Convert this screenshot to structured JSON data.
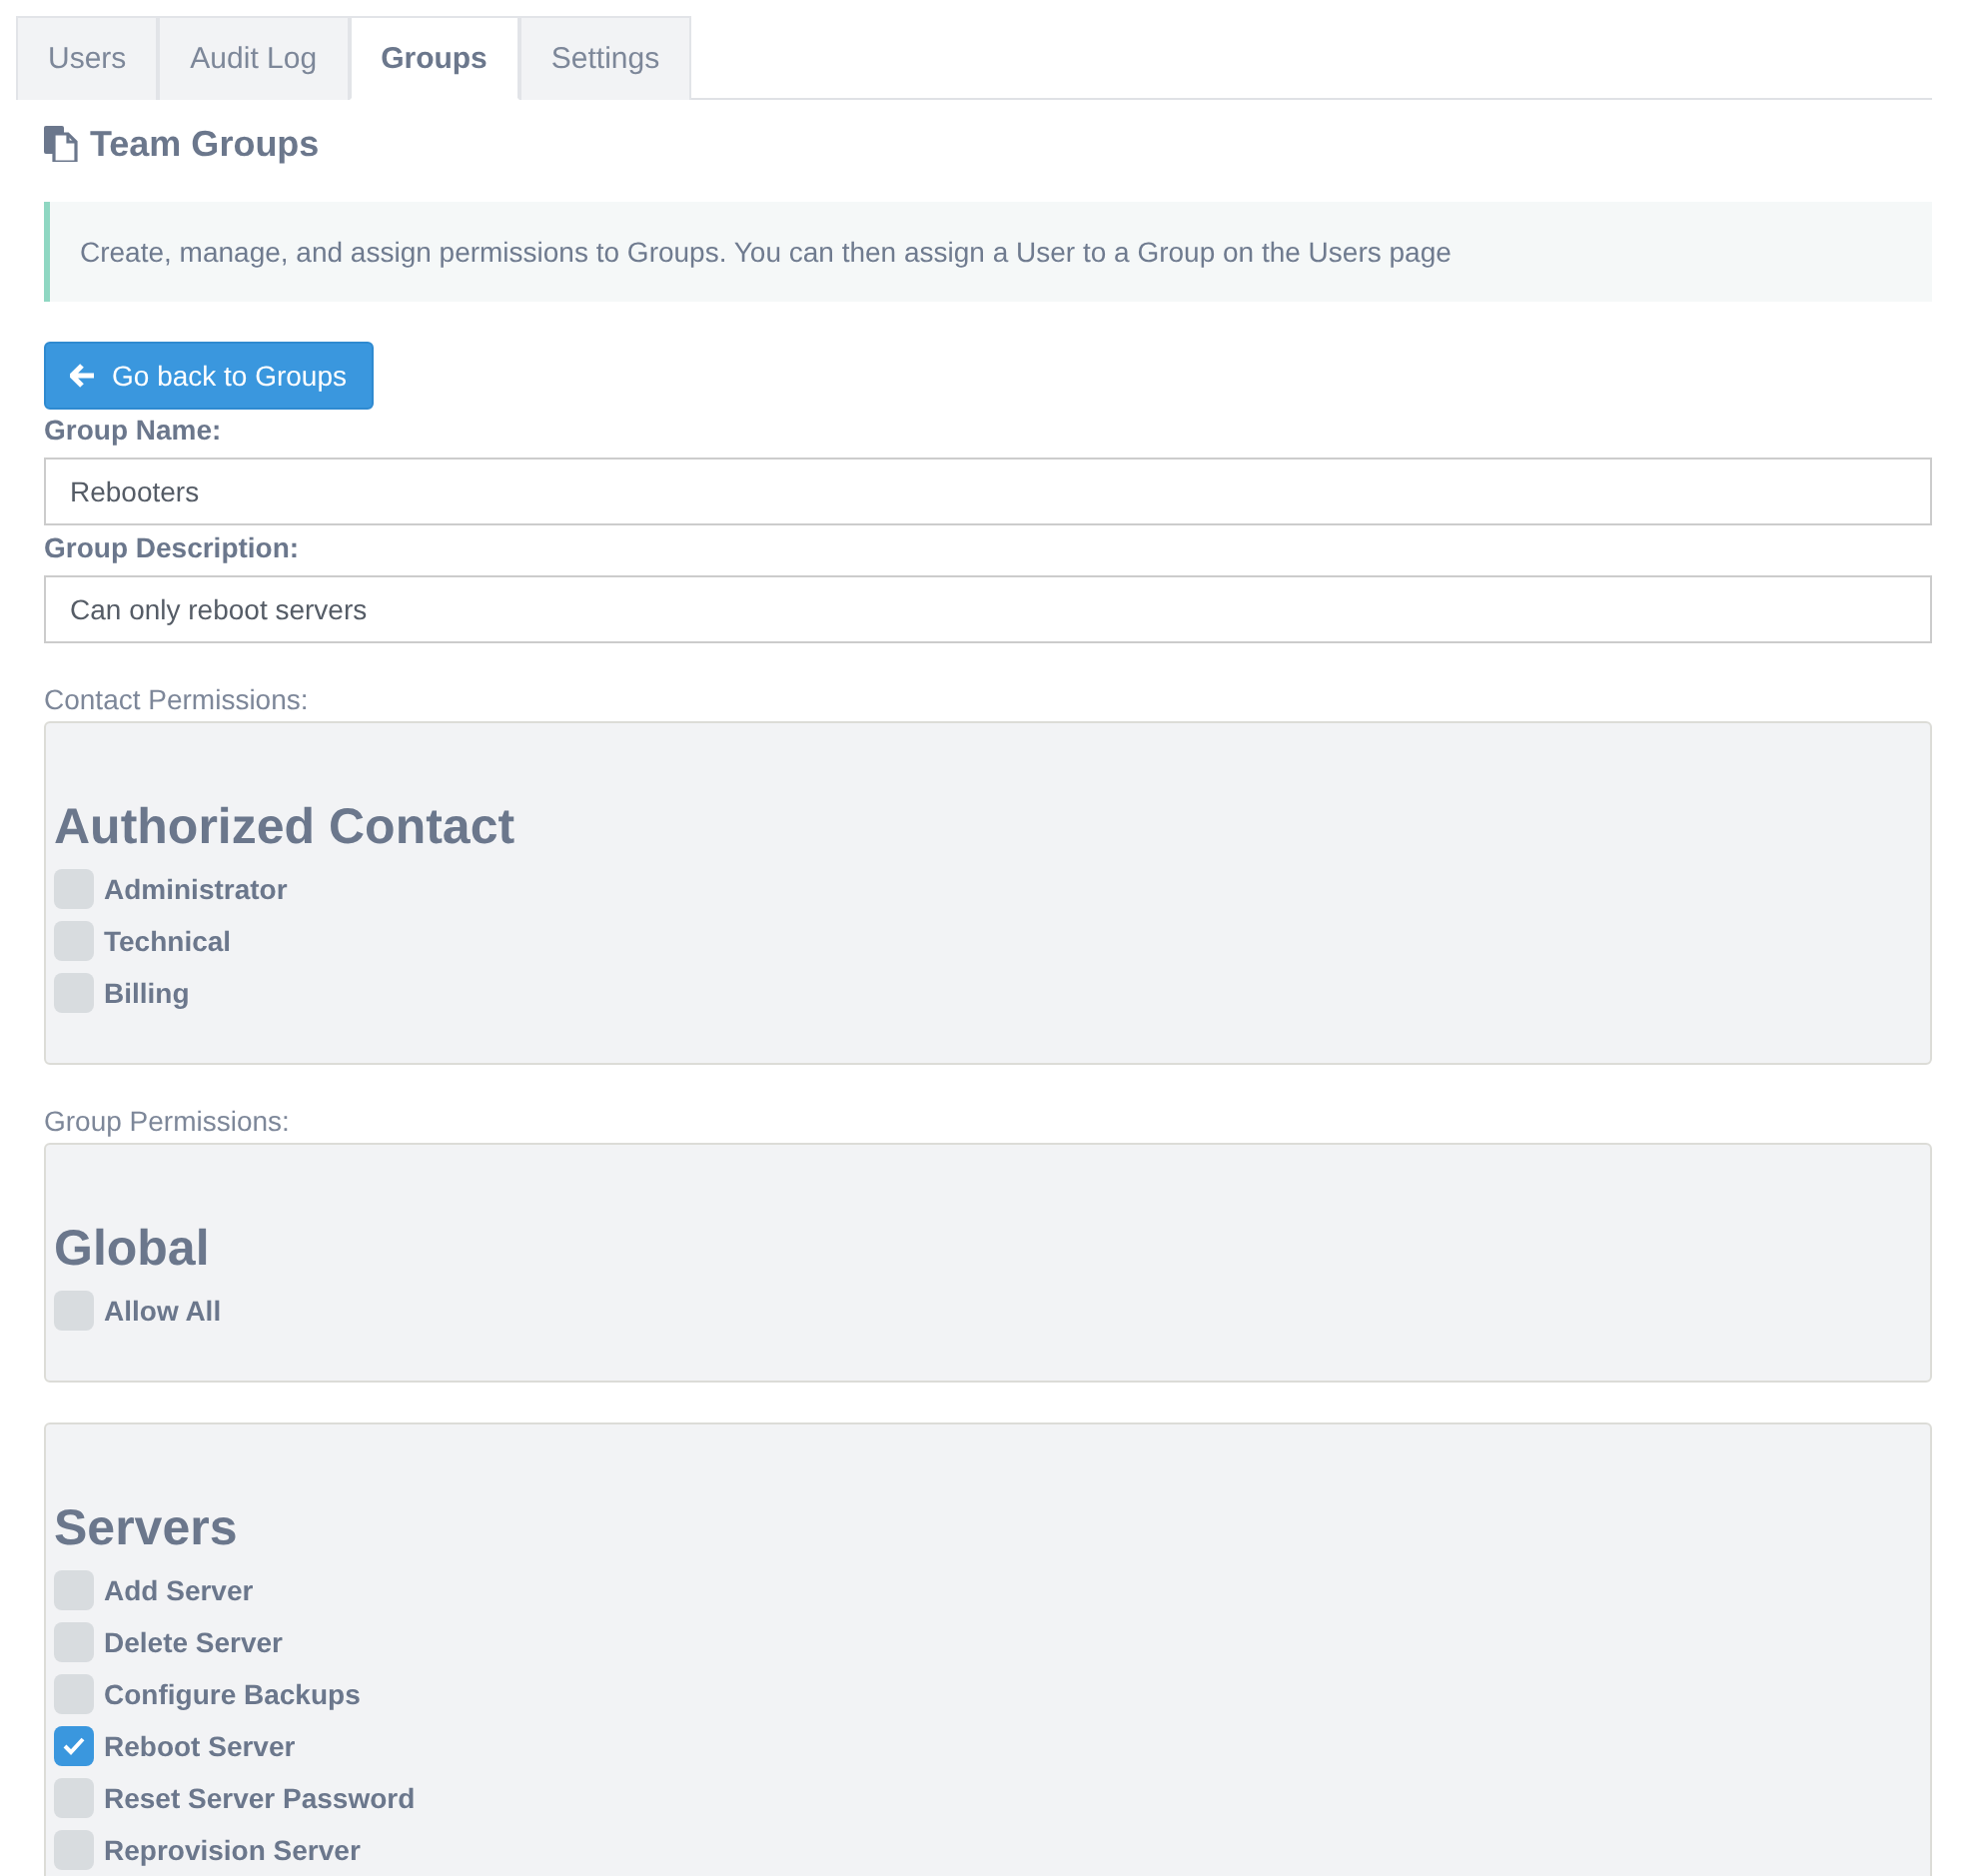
{
  "tabs": [
    {
      "label": "Users",
      "selected": false
    },
    {
      "label": "Audit Log",
      "selected": false
    },
    {
      "label": "Groups",
      "selected": true
    },
    {
      "label": "Settings",
      "selected": false
    }
  ],
  "page_title": "Team Groups",
  "info": "Create, manage, and assign permissions to Groups. You can then assign a User to a Group on the Users page",
  "back_button": "Go back to Groups",
  "fields": [
    {
      "label": "Group Name:",
      "value": "Rebooters"
    },
    {
      "label": "Group Description:",
      "value": "Can only reboot servers"
    }
  ],
  "sections": [
    {
      "label": "Contact Permissions:",
      "panels": [
        {
          "title": "Authorized Contact",
          "items": [
            {
              "label": "Administrator",
              "checked": false
            },
            {
              "label": "Technical",
              "checked": false
            },
            {
              "label": "Billing",
              "checked": false
            }
          ]
        }
      ]
    },
    {
      "label": "Group Permissions:",
      "panels": [
        {
          "title": "Global",
          "items": [
            {
              "label": "Allow All",
              "checked": false
            }
          ]
        },
        {
          "title": "Servers",
          "items": [
            {
              "label": "Add Server",
              "checked": false
            },
            {
              "label": "Delete Server",
              "checked": false
            },
            {
              "label": "Configure Backups",
              "checked": false
            },
            {
              "label": "Reboot Server",
              "checked": true
            },
            {
              "label": "Reset Server Password",
              "checked": false
            },
            {
              "label": "Reprovision Server",
              "checked": false
            }
          ]
        }
      ]
    }
  ]
}
